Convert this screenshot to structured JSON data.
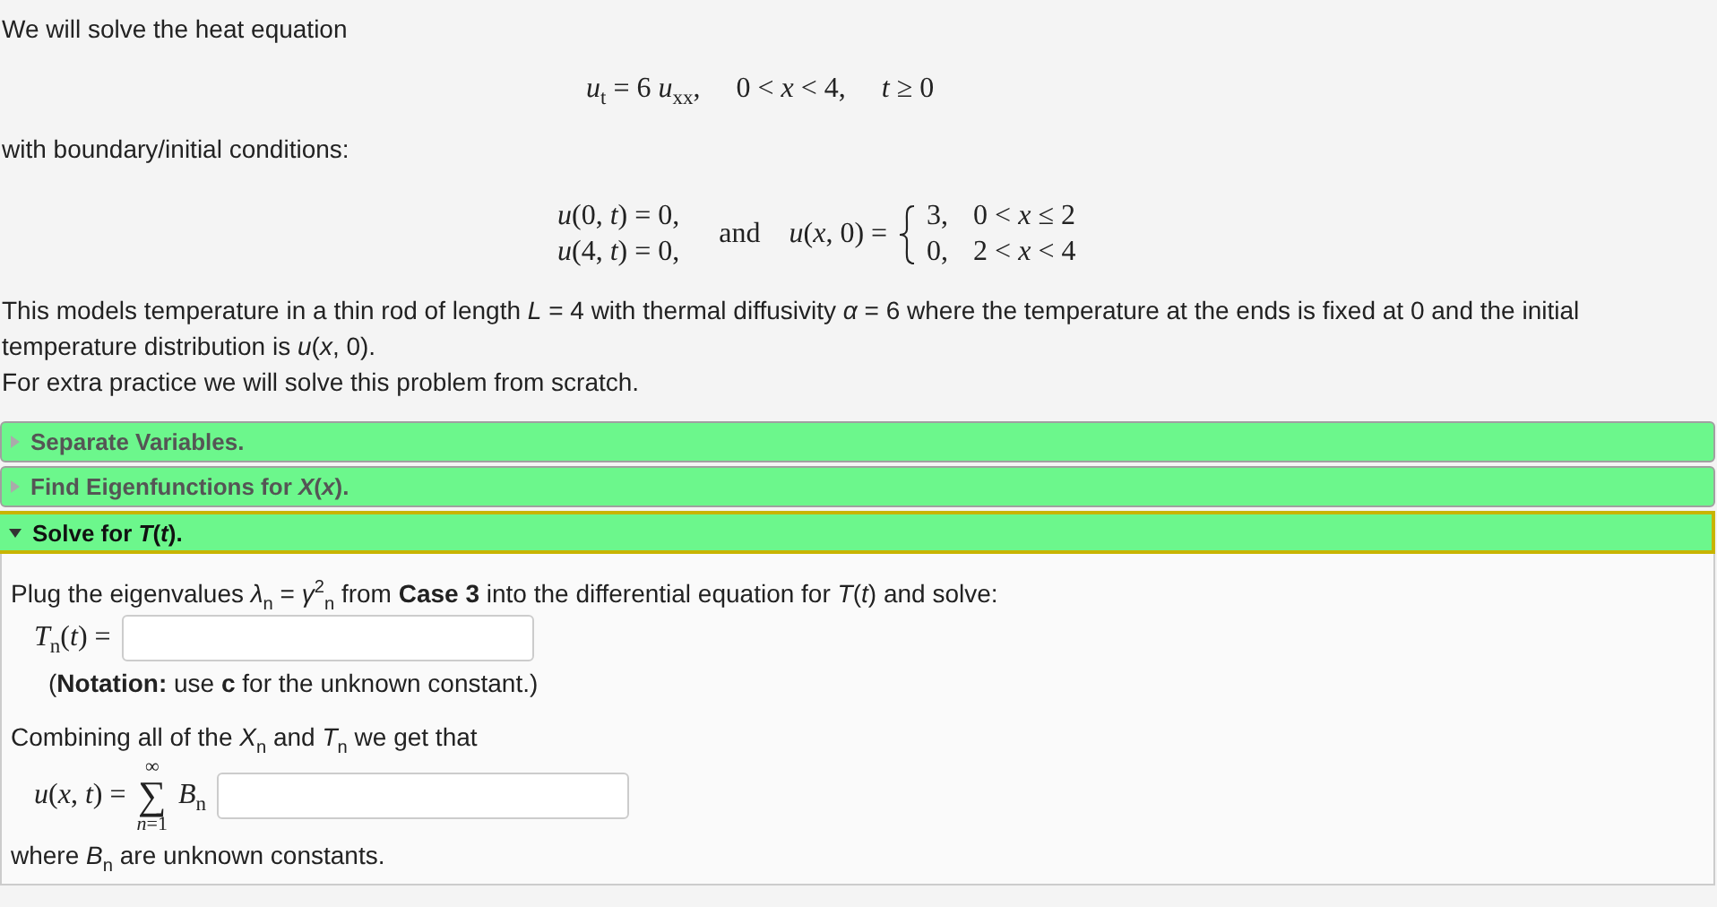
{
  "intro": "We will solve the heat equation",
  "equation": "*u*$_{t}$ = 6 *u*$_{xx}$,     0 < *x* < 4,     *t* ≥ 0",
  "conditions_label": "with boundary/initial conditions:",
  "boundary": [
    "*u*(0, *t*) = 0,",
    "*u*(4, *t*) = 0,"
  ],
  "joiner": "and",
  "initial": {
    "lhs": "*u*(*x*, 0) =",
    "cases": [
      {
        "value": "3,",
        "range": "0 < *x* ≤ 2"
      },
      {
        "value": "0,",
        "range": "2 < *x* < 4"
      }
    ]
  },
  "description": [
    "This models temperature in a thin rod of length *L* = 4 with thermal diffusivity *α* = 6 where the temperature at the ends is fixed at 0 and the initial temperature distribution is *u*(*x*, 0).",
    "For extra practice we will solve this problem from scratch."
  ],
  "sections": [
    {
      "title": "Separate Variables.",
      "expanded": false
    },
    {
      "title": "Find Eigenfunctions for *X*(*x*).",
      "expanded": false
    },
    {
      "title": "Solve for *T*(*t*).",
      "expanded": true,
      "body": {
        "instruction": "Plug the eigenvalues *λ*$_{n}$ = *γ*$^{2}$$_{n}$ from **Case 3** into the differential equation for *T*(*t*) and solve:",
        "answer_label": "*T*$_{n}$(*t*) =",
        "note": "(**Notation:** use **c** for the unknown constant.)",
        "combine": "Combining all of the *X*$_{n}$ and *T*$_{n}$ we get that",
        "sum": {
          "lhs": "*u*(*x*, *t*) =",
          "symbol": "∑",
          "upper": "∞",
          "lower": "*n*=1",
          "term": "*B*$_{n}$"
        },
        "closing": "where *B*$_{n}$ are unknown constants."
      }
    }
  ]
}
